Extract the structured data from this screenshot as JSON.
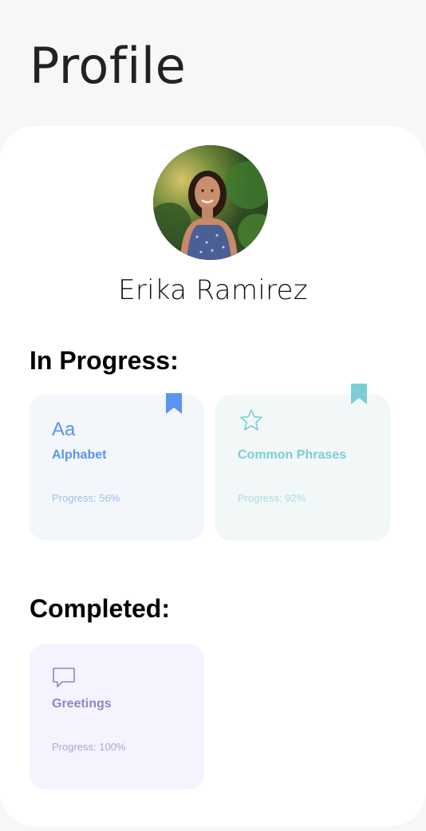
{
  "page": {
    "title": "Profile"
  },
  "profile": {
    "name": "Erika Ramirez"
  },
  "in_progress": {
    "heading": "In Progress:",
    "courses": [
      {
        "icon_text": "Aa",
        "icon": "alphabet-icon",
        "name": "Alphabet",
        "progress_label": "Progress: 56%",
        "progress": 0.56,
        "bookmarked": true,
        "accent": "#5b93f2"
      },
      {
        "icon": "star-icon",
        "name": "Common Phrases",
        "progress_label": "Progress: 92%",
        "progress": 0.92,
        "bookmarked": true,
        "accent": "#7ccdd6"
      }
    ]
  },
  "completed": {
    "heading": "Completed:",
    "courses": [
      {
        "icon": "speech-bubble-icon",
        "name": "Greetings",
        "progress_label": "Progress: 100%",
        "progress": 1.0,
        "accent": "#8b87c6"
      }
    ]
  },
  "colors": {
    "background": "#f7f7f7",
    "sheet": "#ffffff",
    "card_blue": "#f3f7fb",
    "card_teal": "#f2f7f8",
    "card_purple": "#f5f3fe",
    "progress_blue": "#9fc0ec",
    "progress_teal": "#a9dbe0",
    "progress_purple": "#aaa6d8"
  }
}
